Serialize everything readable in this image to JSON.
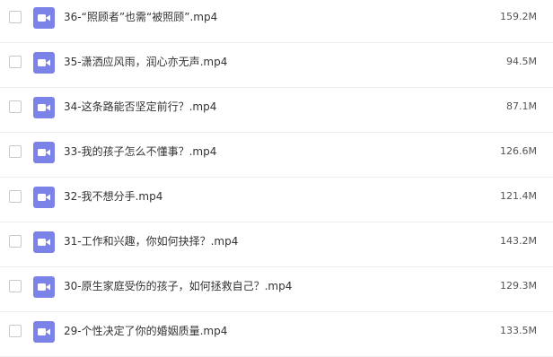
{
  "files": [
    {
      "name": "36-“照顾者”也需“被照顾”.mp4",
      "size": "159.2M",
      "icon": "video-icon"
    },
    {
      "name": "35-潇洒应风雨，润心亦无声.mp4",
      "size": "94.5M",
      "icon": "video-icon"
    },
    {
      "name": "34-这条路能否坚定前行？.mp4",
      "size": "87.1M",
      "icon": "video-icon"
    },
    {
      "name": "33-我的孩子怎么不懂事？.mp4",
      "size": "126.6M",
      "icon": "video-icon"
    },
    {
      "name": "32-我不想分手.mp4",
      "size": "121.4M",
      "icon": "video-icon"
    },
    {
      "name": "31-工作和兴趣，你如何抉择？.mp4",
      "size": "143.2M",
      "icon": "video-icon"
    },
    {
      "name": "30-原生家庭受伤的孩子，如何拯救自己？.mp4",
      "size": "129.3M",
      "icon": "video-icon"
    },
    {
      "name": "29-个性决定了你的婚姻质量.mp4",
      "size": "133.5M",
      "icon": "video-icon"
    }
  ],
  "colors": {
    "video_icon_bg": "#7b82e8",
    "row_divider": "#eeeeee",
    "text": "#333333"
  }
}
